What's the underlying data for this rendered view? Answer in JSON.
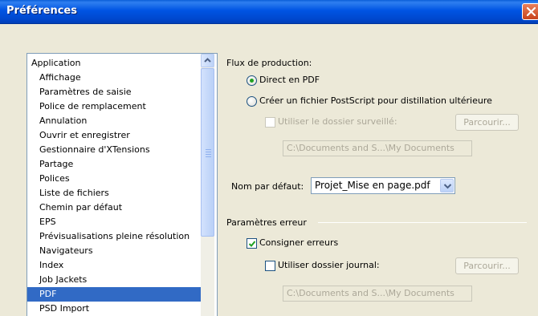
{
  "window": {
    "title": "Préférences"
  },
  "list": {
    "items": [
      {
        "label": "Application",
        "level": "root",
        "selected": false
      },
      {
        "label": "Affichage",
        "level": "child",
        "selected": false
      },
      {
        "label": "Paramètres de saisie",
        "level": "child",
        "selected": false
      },
      {
        "label": "Police de remplacement",
        "level": "child",
        "selected": false
      },
      {
        "label": "Annulation",
        "level": "child",
        "selected": false
      },
      {
        "label": "Ouvrir et enregistrer",
        "level": "child",
        "selected": false
      },
      {
        "label": "Gestionnaire d'XTensions",
        "level": "child",
        "selected": false
      },
      {
        "label": "Partage",
        "level": "child",
        "selected": false
      },
      {
        "label": "Polices",
        "level": "child",
        "selected": false
      },
      {
        "label": "Liste de fichiers",
        "level": "child",
        "selected": false
      },
      {
        "label": "Chemin par défaut",
        "level": "child",
        "selected": false
      },
      {
        "label": "EPS",
        "level": "child",
        "selected": false
      },
      {
        "label": "Prévisualisations pleine résolution",
        "level": "child",
        "selected": false
      },
      {
        "label": "Navigateurs",
        "level": "child",
        "selected": false
      },
      {
        "label": "Index",
        "level": "child",
        "selected": false
      },
      {
        "label": "Job Jackets",
        "level": "child",
        "selected": false
      },
      {
        "label": "PDF",
        "level": "child",
        "selected": true
      },
      {
        "label": "PSD Import",
        "level": "child",
        "selected": false
      }
    ]
  },
  "workflow": {
    "heading": "Flux de production:",
    "radio_direct": "Direct en PDF",
    "radio_postscript": "Créer un fichier PostScript pour distillation ultérieure",
    "radio_selected": "direct",
    "watched_folder_label": "Utiliser le dossier surveillé:",
    "watched_folder_checked": false,
    "browse_label": "Parcourir...",
    "watched_folder_path": "C:\\Documents and S...\\My Documents"
  },
  "default_name": {
    "label": "Nom par défaut:",
    "value": "Projet_Mise en page.pdf"
  },
  "errors": {
    "heading": "Paramètres erreur",
    "log_errors_label": "Consigner erreurs",
    "log_errors_checked": true,
    "log_folder_label": "Utiliser dossier journal:",
    "log_folder_checked": false,
    "browse_label": "Parcourir...",
    "log_folder_path": "C:\\Documents and S...\\My Documents"
  }
}
